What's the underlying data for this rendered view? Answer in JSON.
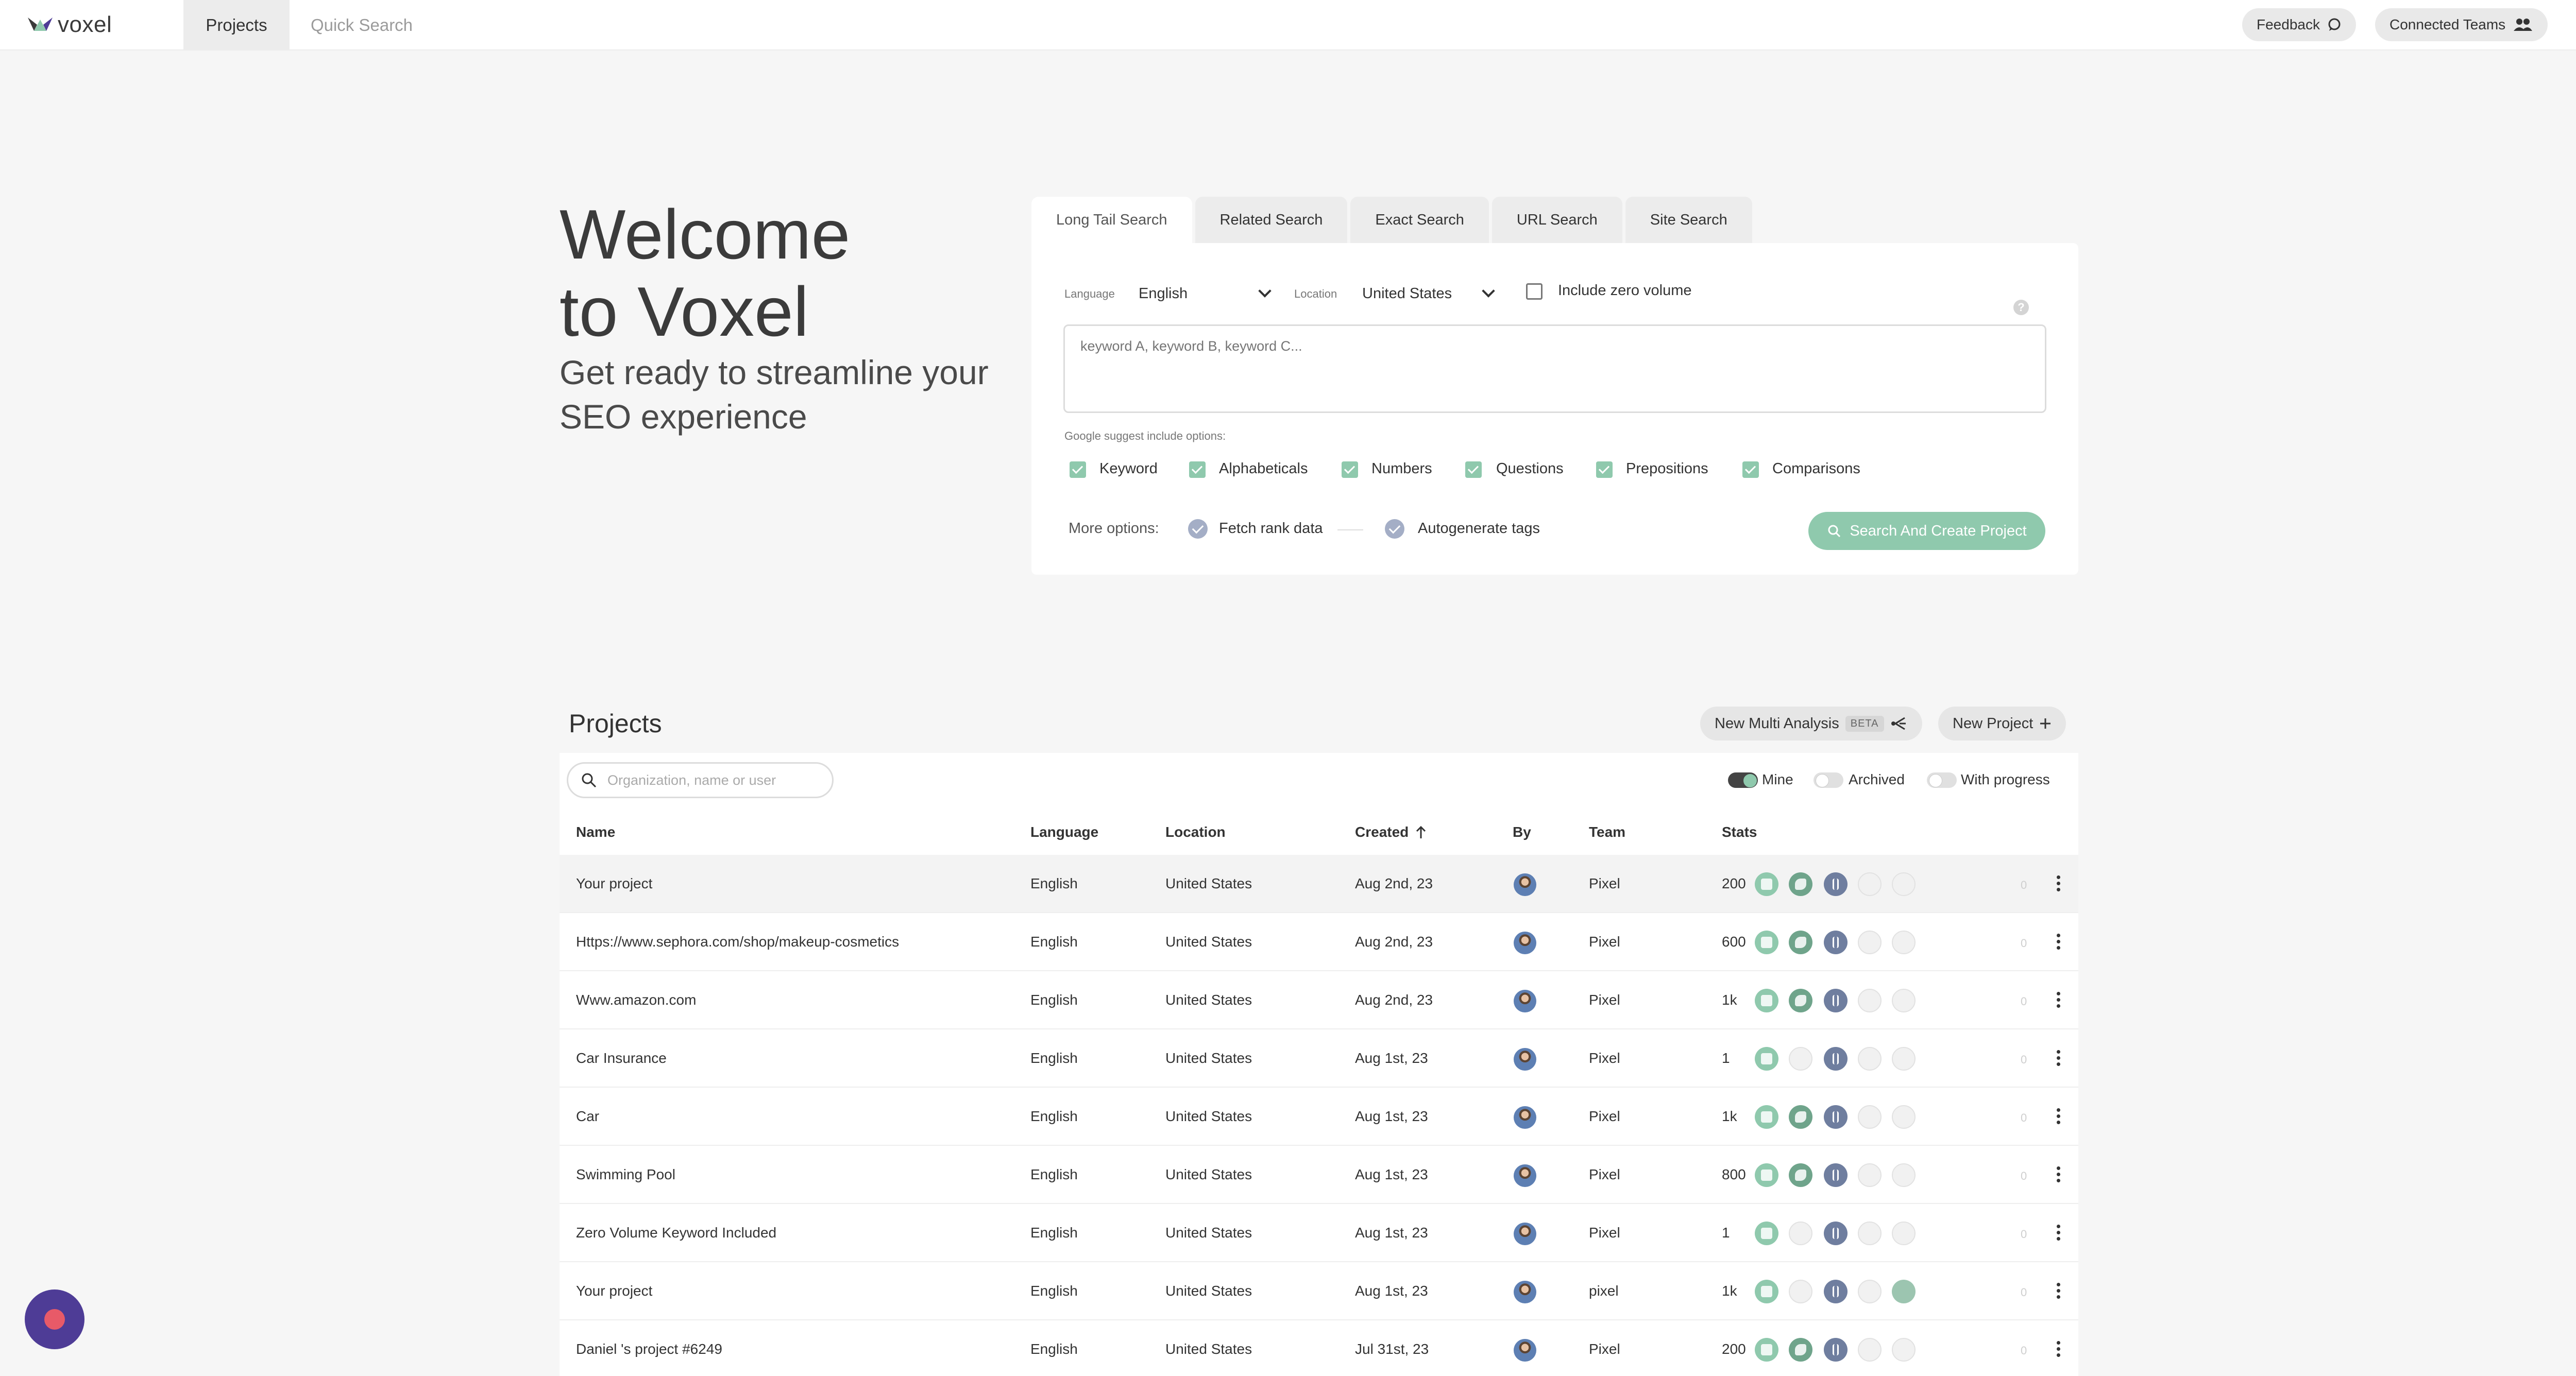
{
  "brand": {
    "name": "voxel"
  },
  "nav": {
    "tabs": [
      {
        "label": "Projects",
        "active": true
      },
      {
        "label": "Quick Search",
        "active": false
      }
    ],
    "feedback_label": "Feedback",
    "connected_teams_label": "Connected Teams"
  },
  "hero": {
    "title": "Welcome to Voxel",
    "subtitle": "Get ready to streamline your SEO experience"
  },
  "search": {
    "tabs": [
      "Long Tail Search",
      "Related Search",
      "Exact Search",
      "URL Search",
      "Site Search"
    ],
    "active_tab": "Long Tail Search",
    "language_label": "Language",
    "language_value": "English",
    "location_label": "Location",
    "location_value": "United States",
    "zero_volume_label": "Include zero volume",
    "zero_volume_checked": false,
    "keywords_placeholder": "keyword A, keyword B, keyword C...",
    "suggest_label": "Google suggest include options:",
    "suggest_options": [
      "Keyword",
      "Alphabeticals",
      "Numbers",
      "Questions",
      "Prepositions",
      "Comparisons"
    ],
    "more_options_label": "More options:",
    "fetch_rank_label": "Fetch rank data",
    "autogenerate_label": "Autogenerate tags",
    "submit_label": "Search And Create Project",
    "help_icon": "?"
  },
  "projects": {
    "title": "Projects",
    "new_multi_label": "New Multi Analysis",
    "beta_label": "BETA",
    "new_project_label": "New Project",
    "search_placeholder": "Organization, name or user",
    "toggles": {
      "mine": {
        "label": "Mine",
        "on": true
      },
      "archived": {
        "label": "Archived",
        "on": false
      },
      "progress": {
        "label": "With progress",
        "on": false
      }
    },
    "columns": [
      "Name",
      "Language",
      "Location",
      "Created",
      "By",
      "Team",
      "Stats"
    ],
    "rows": [
      {
        "name": "Your project",
        "language": "English",
        "location": "United States",
        "created": "Aug 2nd, 23",
        "team": "Pixel",
        "stats": "200"
      },
      {
        "name": "Https://www.sephora.com/shop/makeup-cosmetics",
        "language": "English",
        "location": "United States",
        "created": "Aug 2nd, 23",
        "team": "Pixel",
        "stats": "600"
      },
      {
        "name": "Www.amazon.com",
        "language": "English",
        "location": "United States",
        "created": "Aug 2nd, 23",
        "team": "Pixel",
        "stats": "1k"
      },
      {
        "name": "Car Insurance",
        "language": "English",
        "location": "United States",
        "created": "Aug 1st, 23",
        "team": "Pixel",
        "stats": "1"
      },
      {
        "name": "Car",
        "language": "English",
        "location": "United States",
        "created": "Aug 1st, 23",
        "team": "Pixel",
        "stats": "1k"
      },
      {
        "name": "Swimming Pool",
        "language": "English",
        "location": "United States",
        "created": "Aug 1st, 23",
        "team": "Pixel",
        "stats": "800"
      },
      {
        "name": "Zero Volume Keyword Included",
        "language": "English",
        "location": "United States",
        "created": "Aug 1st, 23",
        "team": "Pixel",
        "stats": "1"
      },
      {
        "name": "Your project",
        "language": "English",
        "location": "United States",
        "created": "Aug 1st, 23",
        "team": "pixel",
        "stats": "1k"
      },
      {
        "name": "Daniel 's project #6249",
        "language": "English",
        "location": "United States",
        "created": "Jul 31st, 23",
        "team": "Pixel",
        "stats": "200"
      }
    ],
    "row_ghost_count": "0"
  },
  "colors": {
    "accent": "#8fc9ad",
    "stat_blue": "#6f7e9f",
    "chat": "#4e3c96",
    "chat_dot": "#e85a68"
  },
  "icons": {
    "logo": "voxel-logo-icon",
    "feedback": "chat-bubble-icon",
    "teams": "team-icon",
    "avatar": "user-avatar-icon",
    "search": "search-icon",
    "sort": "arrow-up-icon",
    "multi": "branch-icon",
    "plus": "plus-icon",
    "more": "kebab-menu-icon",
    "chat": "chat-widget-icon"
  }
}
